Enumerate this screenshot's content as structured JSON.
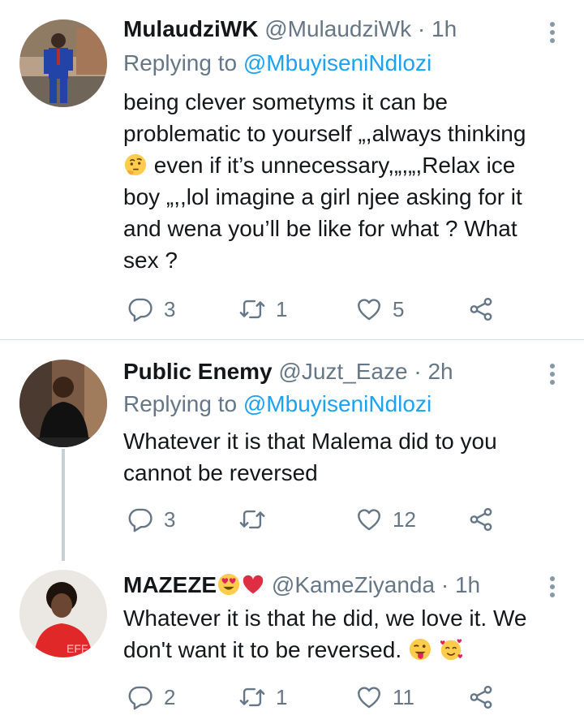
{
  "tweets": [
    {
      "name": "MulaudziWK",
      "handle": "@MulaudziWk",
      "separator": "·",
      "time": "1h",
      "replying_prefix": "Replying to",
      "replying_to": "@MbuyiseniNdlozi",
      "body_lines": [
        "being  clever sometyms it can be",
        "problematic to yourself „,always thinking",
        " even if it’s unnecessary,„,„,Relax ice",
        "boy „,,lol imagine a girl njee asking for it",
        "and wena you’ll be like for what ? What",
        "sex ?"
      ],
      "replies": "3",
      "retweets": "1",
      "likes": "5",
      "emoji": "thinking-face-icon"
    },
    {
      "name": "Public Enemy",
      "handle": "@Juzt_Eaze",
      "separator": "·",
      "time": "2h",
      "replying_prefix": "Replying to",
      "replying_to": "@MbuyiseniNdlozi",
      "body_lines": [
        "Whatever it is that Malema did to you",
        "cannot be reversed"
      ],
      "replies": "3",
      "retweets": "",
      "likes": "12"
    },
    {
      "name": "MAZEZE",
      "name_emojis": [
        "heart-eyes-icon",
        "red-heart-icon"
      ],
      "handle": "@KameZiyanda",
      "separator": "·",
      "time": "1h",
      "body_lines": [
        "Whatever it is that he did, we love it. We",
        "don't want it to be reversed."
      ],
      "body_emojis": [
        "winking-tongue-face-icon",
        "smiling-face-with-hearts-icon"
      ],
      "replies": "2",
      "retweets": "1",
      "likes": "11"
    }
  ],
  "colors": {
    "text": "#14171a",
    "secondary": "#657786",
    "link": "#1da1f2",
    "divider": "#d8dde2",
    "thread_line": "#c8d0d7"
  }
}
